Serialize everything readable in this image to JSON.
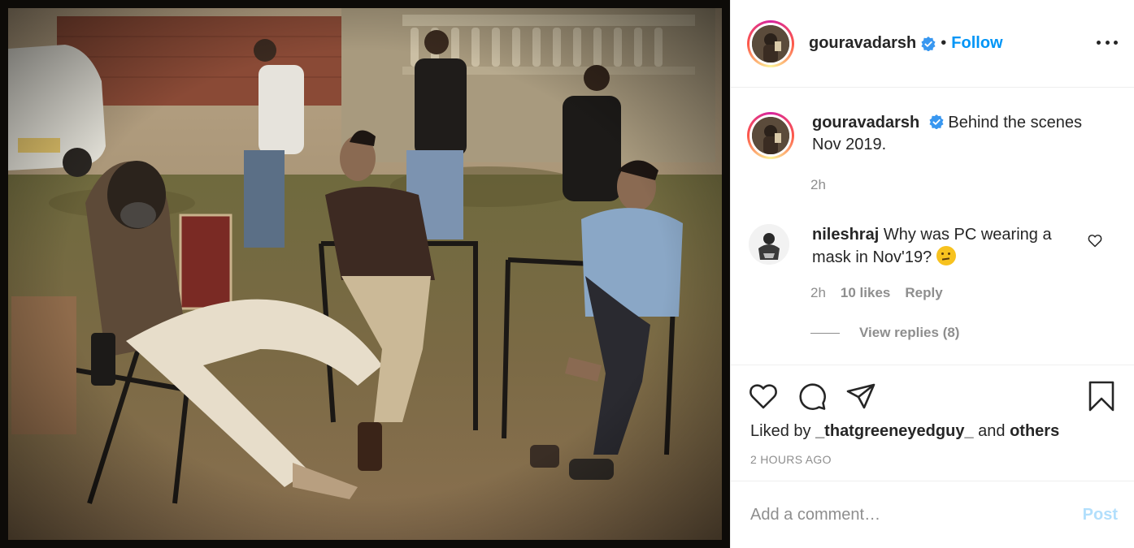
{
  "post": {
    "image_alt": "Behind the scenes photo",
    "author": "gouravadarsh",
    "follow_label": "Follow",
    "dot": "•"
  },
  "caption": {
    "username": "gouravadarsh",
    "text": "Behind the scenes Nov 2019.",
    "time": "2h"
  },
  "comment": {
    "username": "nileshraj",
    "text": "Why was PC wearing a mask in Nov'19?",
    "time": "2h",
    "likes": "10 likes",
    "reply_label": "Reply"
  },
  "view_replies": "View replies (8)",
  "likes_line": {
    "prefix": "Liked by",
    "user": "_thatgreeneyedguy_",
    "and": "and",
    "others": "others"
  },
  "posted_ago": "2 HOURS AGO",
  "add_comment": {
    "placeholder": "Add a comment…",
    "post_label": "Post"
  },
  "colors": {
    "link_blue": "#0095f6",
    "post_disabled": "#b2dffc",
    "muted": "#8e8e8e",
    "text": "#262626"
  },
  "icons": [
    "verified-badge-icon",
    "more-options-icon",
    "heart-icon",
    "comment-icon",
    "share-icon",
    "bookmark-icon",
    "heart-small-icon"
  ]
}
